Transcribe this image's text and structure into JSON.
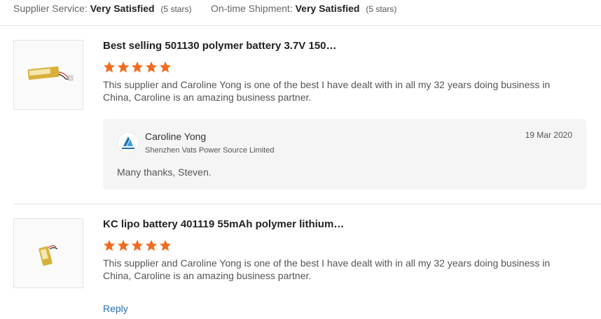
{
  "summary": {
    "supplier_service": {
      "label": "Supplier Service:",
      "value": "Very Satisfied",
      "note": "(5 stars)"
    },
    "ontime_shipment": {
      "label": "On-time Shipment:",
      "value": "Very Satisfied",
      "note": "(5 stars)"
    }
  },
  "reviews": [
    {
      "product_title": "Best selling 501130 polymer battery 3.7V 150…",
      "rating": 5,
      "text": "This  supplier and Caroline Yong is one of the best I have dealt with in all my 32 years doing business in China, Caroline is an amazing business partner.",
      "thumb_icon": "battery-product-image",
      "reply": {
        "name": "Caroline Yong",
        "company": "Shenzhen Vats Power Source Limited",
        "date": "19 Mar 2020",
        "text": "Many thanks, Steven.",
        "logo_icon": "company-logo"
      }
    },
    {
      "product_title": "KC lipo battery 401119 55mAh polymer lithium…",
      "rating": 5,
      "text": "This  supplier and Caroline Yong is one of the best I have dealt with in all my 32 years doing business in China, Caroline is an amazing business partner.",
      "thumb_icon": "battery-product-image",
      "reply_label": "Reply"
    }
  ],
  "colors": {
    "star": "#f26b1d",
    "link": "#2a6fb5",
    "reply_bg": "#f5f5f5"
  }
}
